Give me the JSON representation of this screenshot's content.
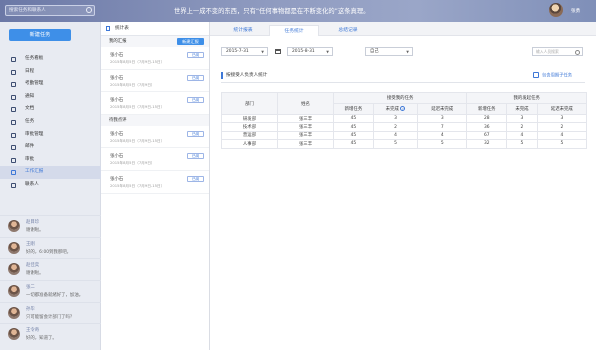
{
  "header": {
    "search_placeholder": "搜索任务和联系人",
    "slogan": "世界上一成不变的东西，只有“任何事物都是在不断变化的”这条真理。",
    "user_name": "张勇"
  },
  "sidebar": {
    "new_task": "新建任务",
    "items": [
      {
        "label": "任务看板",
        "icon": "dashboard-icon"
      },
      {
        "label": "日程",
        "icon": "calendar-icon"
      },
      {
        "label": "考勤管理",
        "icon": "clock-icon"
      },
      {
        "label": "通知",
        "icon": "bell-icon"
      },
      {
        "label": "文档",
        "icon": "document-icon"
      },
      {
        "label": "任务",
        "icon": "task-icon"
      },
      {
        "label": "审批管理",
        "icon": "approval-icon"
      },
      {
        "label": "邮件",
        "icon": "mail-icon"
      },
      {
        "label": "审批",
        "icon": "check-icon"
      },
      {
        "label": "工作汇报",
        "icon": "report-icon"
      },
      {
        "label": "联系人",
        "icon": "contacts-icon"
      }
    ],
    "active_index": 9,
    "contacts": [
      {
        "name": "赵目珍",
        "msg": "谢谢啦。"
      },
      {
        "name": "王刚",
        "msg": "好的，6:00到我那吧。"
      },
      {
        "name": "赵佳奕",
        "msg": "谢谢啦。"
      },
      {
        "name": "张二",
        "msg": "一切都准备就绪好了，加油。"
      },
      {
        "name": "孙毕",
        "msg": "只可能留会计部门了吗？"
      },
      {
        "name": "王令奇",
        "msg": "好的，知道了。"
      }
    ]
  },
  "report_panel": {
    "title": "统计表",
    "my_section": "我的汇报",
    "new_button": "新建汇报",
    "my_reports": [
      {
        "name": "张小石",
        "date": "2015年8月5日（7月9日-15日）",
        "status": "已阅"
      },
      {
        "name": "张小石",
        "date": "2015年8月5日（7月9日）",
        "status": "已阅"
      },
      {
        "name": "张小石",
        "date": "2015年8月5日（7月9日-15日）",
        "status": "已阅"
      }
    ],
    "pending_section": "待我点评",
    "pending_reports": [
      {
        "name": "张小石",
        "date": "2015年8月5日（7月9日-15日）",
        "status": "已阅"
      },
      {
        "name": "张小石",
        "date": "2015年8月5日（7月9日）",
        "status": "已阅"
      },
      {
        "name": "张小石",
        "date": "2015年8月5日（7月9日-15日）",
        "status": "已阅"
      }
    ]
  },
  "main": {
    "tabs": [
      "统计报表",
      "任务统计",
      "总结记录"
    ],
    "active_tab": 1,
    "date_from": "2015-7-31",
    "date_to": "2015-8-31",
    "filter": "自己",
    "search_placeholder": "输入人员搜索",
    "section_title": "按接受人负责人统计",
    "export_label": "包含周期子任务",
    "table": {
      "h_dept": "部门",
      "h_name": "姓名",
      "h_group1": "接受我的任务",
      "h_group2": "我的发起任务",
      "sub": [
        "新增任务",
        "未完成",
        "延迟未完成",
        "新增任务",
        "未完成",
        "延迟未完成"
      ],
      "rows": [
        {
          "dept": "研发部",
          "name": "张三丰",
          "v": [
            "45",
            "3",
            "3",
            "28",
            "3",
            "3"
          ]
        },
        {
          "dept": "技术部",
          "name": "张三丰",
          "v": [
            "45",
            "2",
            "7",
            "36",
            "2",
            "2"
          ]
        },
        {
          "dept": "营运部",
          "name": "张三丰",
          "v": [
            "45",
            "4",
            "4",
            "67",
            "4",
            "4"
          ]
        },
        {
          "dept": "人事部",
          "name": "张三丰",
          "v": [
            "45",
            "5",
            "5",
            "32",
            "5",
            "5"
          ]
        }
      ]
    }
  }
}
